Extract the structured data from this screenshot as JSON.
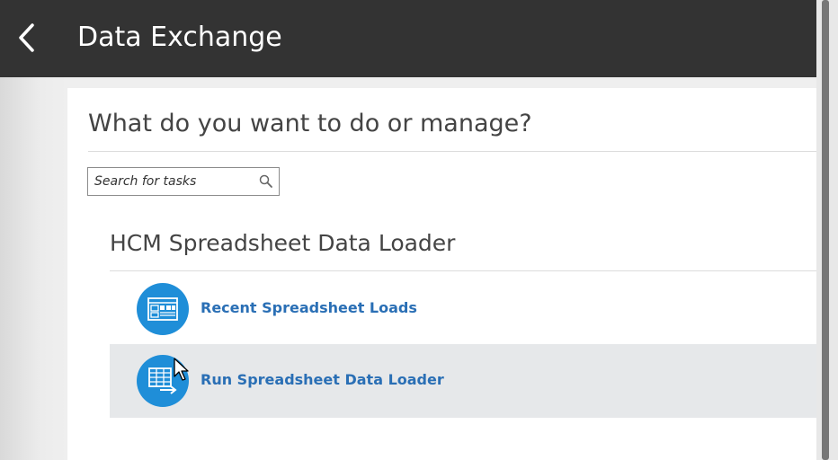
{
  "header": {
    "back_icon": "chevron-left-icon",
    "title": "Data Exchange"
  },
  "main": {
    "question": "What do you want to do or manage?",
    "search": {
      "placeholder": "Search for tasks",
      "value": "",
      "icon": "search-icon"
    },
    "group": {
      "title": "HCM Spreadsheet Data Loader",
      "tasks": [
        {
          "label": "Recent Spreadsheet Loads",
          "icon": "spreadsheet-list-icon",
          "highlighted": false
        },
        {
          "label": "Run Spreadsheet Data Loader",
          "icon": "spreadsheet-run-icon",
          "highlighted": true
        }
      ]
    }
  },
  "colors": {
    "header_bg": "#333333",
    "accent_blue": "#1f8ed8",
    "link_blue": "#2a6fb5",
    "highlight_row": "#e6e8ea"
  }
}
